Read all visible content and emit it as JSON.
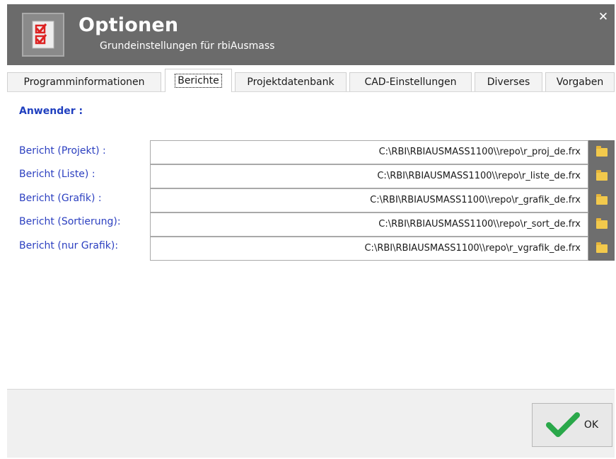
{
  "window": {
    "title": "Optionen",
    "subtitle": "Grundeinstellungen für rbiAusmass",
    "close_glyph": "✕"
  },
  "tabs": [
    {
      "label": "Programminformationen",
      "active": false
    },
    {
      "label": "Berichte",
      "active": true
    },
    {
      "label": "Projektdatenbank",
      "active": false
    },
    {
      "label": "CAD-Einstellungen",
      "active": false
    },
    {
      "label": "Diverses",
      "active": false
    },
    {
      "label": "Vorgaben",
      "active": false
    }
  ],
  "section": {
    "label": "Anwender :"
  },
  "reports": [
    {
      "label": "Bericht (Projekt) :",
      "path": "C:\\RBI\\RBIAUSMASS1100\\\\repo\\r_proj_de.frx"
    },
    {
      "label": "Bericht (Liste) :",
      "path": "C:\\RBI\\RBIAUSMASS1100\\\\repo\\r_liste_de.frx"
    },
    {
      "label": "Bericht (Grafik) :",
      "path": "C:\\RBI\\RBIAUSMASS1100\\\\repo\\r_grafik_de.frx"
    },
    {
      "label": "Bericht (Sortierung):",
      "path": "C:\\RBI\\RBIAUSMASS1100\\\\repo\\r_sort_de.frx"
    },
    {
      "label": "Bericht (nur Grafik):",
      "path": "C:\\RBI\\RBIAUSMASS1100\\\\repo\\r_vgrafik_de.frx"
    }
  ],
  "footer": {
    "ok_label": "OK"
  },
  "colors": {
    "titlebar": "#6b6b6b",
    "label_blue": "#2b3fc0",
    "check_green": "#2aa84a",
    "folder_yellow": "#f2c94c"
  }
}
